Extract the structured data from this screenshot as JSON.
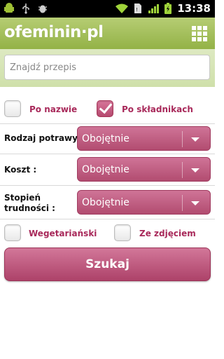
{
  "status_bar": {
    "time": "13:38",
    "icons": [
      "android-icon",
      "usb-icon",
      "debug-icon",
      "wifi-icon",
      "sim-icon",
      "signal-icon",
      "battery-icon"
    ]
  },
  "header": {
    "logo_text": "ofeminin·pl",
    "menu_icon": "grid-icon",
    "color": "#9ab94f"
  },
  "search": {
    "placeholder": "Znajdź przepis",
    "value": ""
  },
  "mode": {
    "by_name": {
      "label": "Po nazwie",
      "checked": false
    },
    "by_ingredients": {
      "label": "Po składnikach",
      "checked": true
    }
  },
  "filters": {
    "dish_type": {
      "label": "Rodzaj potrawy :",
      "value": "Obojętnie"
    },
    "cost": {
      "label": "Koszt :",
      "value": "Obojętnie"
    },
    "difficulty": {
      "label_line1": "Stopień",
      "label_line2": "trudności :",
      "value": "Obojętnie"
    }
  },
  "options": {
    "vegetarian": {
      "label": "Wegetariański",
      "checked": false
    },
    "with_photo": {
      "label": "Ze zdjęciem",
      "checked": false
    }
  },
  "submit_label": "Szukaj",
  "accent_color": "#b84d74"
}
